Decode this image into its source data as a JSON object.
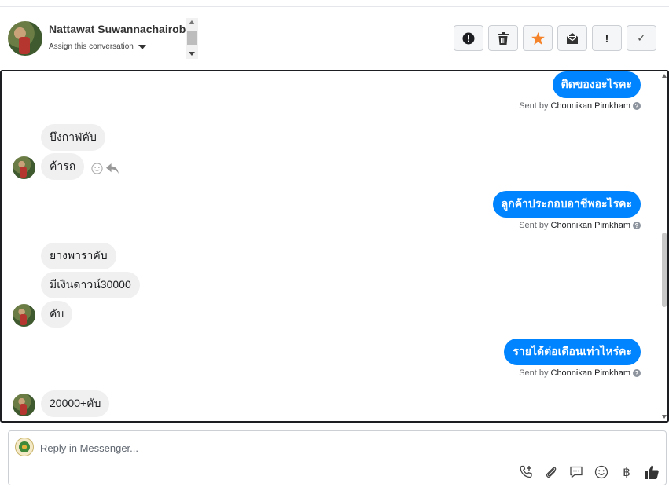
{
  "header": {
    "contact_name": "Nattawat Suwannachairob",
    "assign_label": "Assign this conversation"
  },
  "actions": [
    {
      "name": "spam",
      "icon": "alert-circle-icon",
      "glyph": "!"
    },
    {
      "name": "delete",
      "icon": "trash-icon",
      "glyph": ""
    },
    {
      "name": "star",
      "icon": "star-icon",
      "glyph": "★",
      "color": "#f5832a"
    },
    {
      "name": "mark-unread",
      "icon": "envelope-icon",
      "glyph": ""
    },
    {
      "name": "important",
      "icon": "exclamation-icon",
      "glyph": "!"
    },
    {
      "name": "done",
      "icon": "check-icon",
      "glyph": "✓"
    }
  ],
  "messages": {
    "out1": "ติดของอะไรคะ",
    "in1": "บึงกาฬคับ",
    "in2": "ค้ารถ",
    "out2": "ลูกค้าประกอบอาชีพอะไรคะ",
    "in3": "ยางพาราคับ",
    "in4": "มีเงินดาวน์30000",
    "in5": "คับ",
    "out3": "รายได้ต่อเดือนเท่าไหร่คะ",
    "in6": "20000+คับ"
  },
  "sent_by": {
    "prefix": "Sent by",
    "agent_name": "Chonnikan Pimkham"
  },
  "composer": {
    "placeholder": "Reply in Messenger...",
    "tools": [
      "phone-add-icon",
      "paperclip-icon",
      "saved-reply-icon",
      "emoji-icon",
      "baht-icon",
      "thumbs-up-icon"
    ]
  },
  "colors": {
    "outgoing_bubble": "#0084ff",
    "incoming_bubble": "#f0f0f0",
    "star": "#f5832a"
  }
}
